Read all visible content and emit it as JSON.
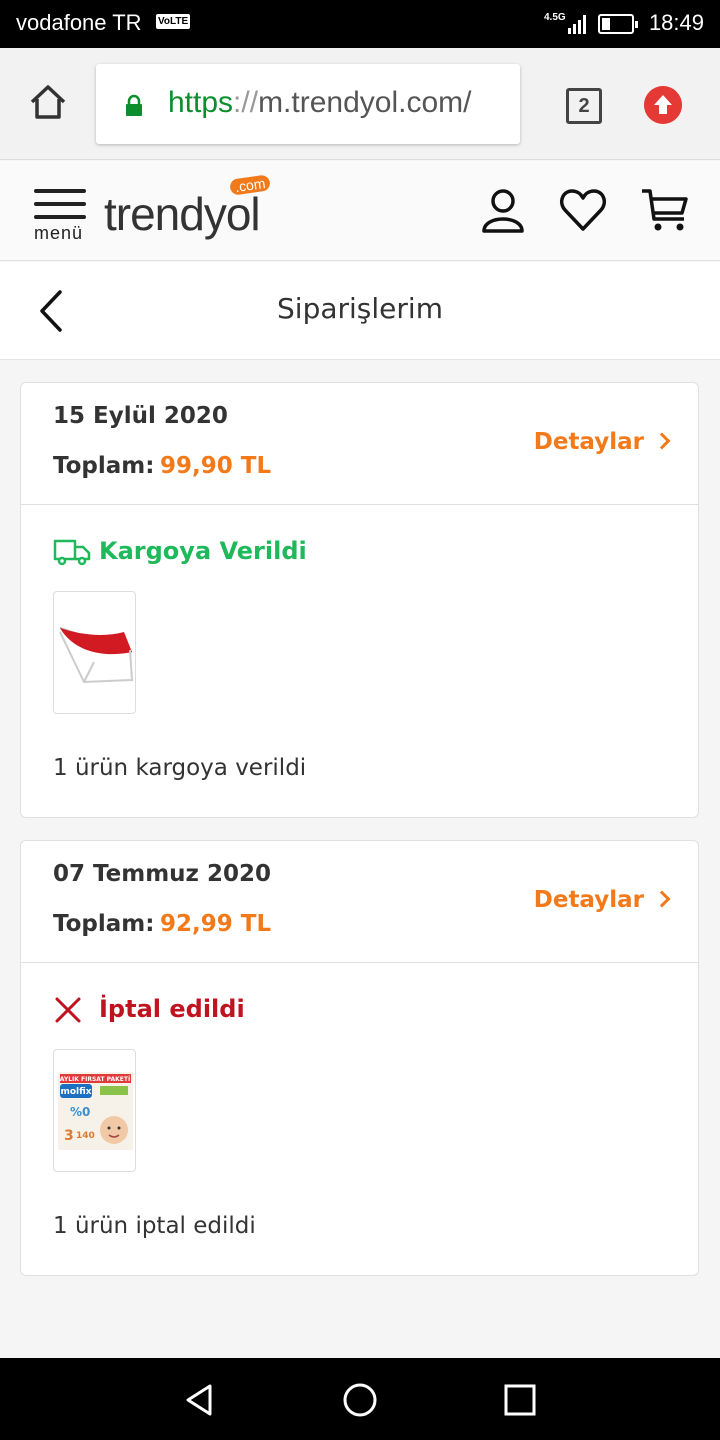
{
  "status_bar": {
    "carrier": "vodafone TR",
    "volte": "VoLTE",
    "network": "4.5G",
    "time": "18:49"
  },
  "browser": {
    "url_scheme": "https",
    "url_separator": "://",
    "url_rest": "m.trendyol.com/",
    "tab_count": "2"
  },
  "site": {
    "logo_word": "trendyol",
    "logo_com": ".com",
    "menu_label": "menü"
  },
  "page": {
    "title": "Siparişlerim"
  },
  "orders": [
    {
      "date": "15 Eylül 2020",
      "total_label": "Toplam:",
      "total_value": "99,90 TL",
      "details_label": "Detaylar",
      "status": "Kargoya Verildi",
      "status_color": "#1fb85a",
      "summary": "1 ürün kargoya verildi"
    },
    {
      "date": "07 Temmuz 2020",
      "total_label": "Toplam:",
      "total_value": "92,99 TL",
      "details_label": "Detaylar",
      "status": "İptal edildi",
      "status_color": "#c1121f",
      "summary": "1 ürün iptal edildi",
      "thumb_text": {
        "banner": "AYLIK FIRSAT PAKETİ",
        "brand": "molfix",
        "size": "3",
        "count": "140"
      }
    }
  ],
  "colors": {
    "accent": "#f27a1a",
    "shipped": "#1fb85a",
    "cancelled": "#c1121f"
  }
}
